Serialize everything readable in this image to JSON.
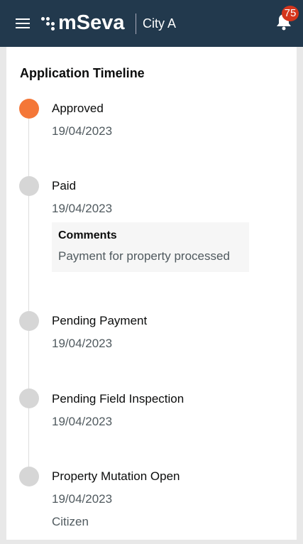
{
  "header": {
    "brand": "mSeva",
    "city": "City A",
    "notification_count": "75",
    "colors": {
      "bar": "#22394d",
      "badge": "#d4351c"
    }
  },
  "timeline": {
    "title": "Application Timeline",
    "items": [
      {
        "status": "Approved",
        "date": "19/04/2023",
        "active": true
      },
      {
        "status": "Paid",
        "date": "19/04/2023",
        "comments_label": "Comments",
        "comment": "Payment for property processed"
      },
      {
        "status": "Pending Payment",
        "date": "19/04/2023"
      },
      {
        "status": "Pending Field Inspection",
        "date": "19/04/2023"
      },
      {
        "status": "Property Mutation Open",
        "date": "19/04/2023",
        "actor": "Citizen"
      }
    ],
    "active_color": "#f47738"
  }
}
